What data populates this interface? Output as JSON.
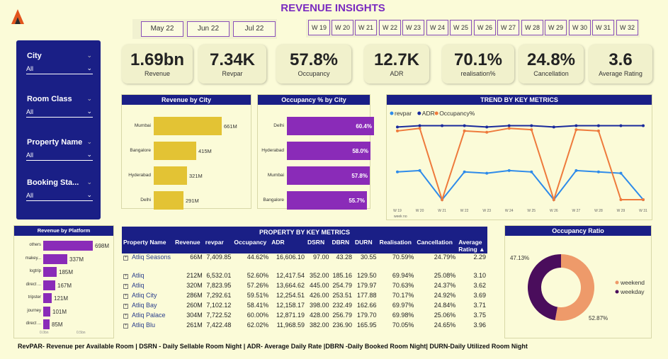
{
  "title": "REVENUE INSIGHTS",
  "months": [
    "May 22",
    "Jun 22",
    "Jul 22"
  ],
  "weeks": [
    "W 19",
    "W 20",
    "W 21",
    "W 22",
    "W 23",
    "W 24",
    "W 25",
    "W 26",
    "W 27",
    "W 28",
    "W 29",
    "W 30",
    "W 31",
    "W 32"
  ],
  "filters": [
    {
      "label": "City",
      "value": "All"
    },
    {
      "label": "Room Class",
      "value": "All"
    },
    {
      "label": "Property Name",
      "value": "All"
    },
    {
      "label": "Booking Sta...",
      "value": "All"
    }
  ],
  "kpis": [
    {
      "value": "1.69bn",
      "label": "Revenue"
    },
    {
      "value": "7.34K",
      "label": "Revpar"
    },
    {
      "value": "57.8%",
      "label": "Occupancy"
    },
    {
      "value": "12.7K",
      "label": "ADR"
    },
    {
      "value": "70.1%",
      "label": "realisation%"
    },
    {
      "value": "24.8%",
      "label": "Cancellation"
    },
    {
      "value": "3.6",
      "label": "Average Rating"
    }
  ],
  "revenue_by_city": {
    "title": "Revenue by City",
    "items": [
      {
        "label": "Mumbai",
        "value": 661,
        "text": "661M"
      },
      {
        "label": "Bangalore",
        "value": 415,
        "text": "415M"
      },
      {
        "label": "Hyderabad",
        "value": 321,
        "text": "321M"
      },
      {
        "label": "Delhi",
        "value": 291,
        "text": "291M"
      }
    ],
    "color": "#E3C334"
  },
  "occupancy_by_city": {
    "title": "Occupancy % by City",
    "items": [
      {
        "label": "Delhi",
        "value": 60.4,
        "text": "60.4%"
      },
      {
        "label": "Hyderabad",
        "value": 58.0,
        "text": "58.0%"
      },
      {
        "label": "Mumbai",
        "value": 57.8,
        "text": "57.8%"
      },
      {
        "label": "Bangalore",
        "value": 55.7,
        "text": "55.7%"
      }
    ],
    "color": "#8A2BB8"
  },
  "revenue_by_platform": {
    "title": "Revenue by Platform",
    "items": [
      {
        "label": "others",
        "value": 698,
        "text": "698M"
      },
      {
        "label": "makey...",
        "value": 337,
        "text": "337M"
      },
      {
        "label": "logtrip",
        "value": 185,
        "text": "185M"
      },
      {
        "label": "direct ...",
        "value": 167,
        "text": "167M"
      },
      {
        "label": "tripster",
        "value": 121,
        "text": "121M"
      },
      {
        "label": "journey",
        "value": 101,
        "text": "101M"
      },
      {
        "label": "direct ...",
        "value": 85,
        "text": "85M"
      }
    ],
    "axis": [
      "0.0bn",
      "0.5bn"
    ],
    "color": "#8A2BB8"
  },
  "chart_data": [
    {
      "type": "line",
      "title": "TREND BY KEY METRICS",
      "xlabel": "week no",
      "legend": "top-left",
      "x": [
        "W 19",
        "W 20",
        "W 21",
        "W 22",
        "W 23",
        "W 24",
        "W 25",
        "W 26",
        "W 27",
        "W 28",
        "W 29",
        "W 31"
      ],
      "series": [
        {
          "name": "revpar",
          "color": "#2E8BEA",
          "values": [
            0.21,
            0.22,
            0.0,
            0.21,
            0.2,
            0.22,
            0.21,
            0.0,
            0.22,
            0.21,
            0.2,
            0.0
          ]
        },
        {
          "name": "ADR",
          "color": "#1A2A9C",
          "values": [
            0.55,
            0.56,
            0.56,
            0.56,
            0.55,
            0.56,
            0.56,
            0.55,
            0.56,
            0.56,
            0.56,
            0.56
          ]
        },
        {
          "name": "Occupancy%",
          "color": "#EE7A3C",
          "values": [
            0.52,
            0.54,
            0.0,
            0.52,
            0.51,
            0.54,
            0.53,
            0.0,
            0.53,
            0.52,
            0.0,
            0.0
          ]
        }
      ]
    },
    {
      "type": "pie",
      "title": "Occupancy Ratio",
      "legend": "right",
      "series": [
        {
          "name": "weekend",
          "value": 52.87,
          "text": "52.87%",
          "color": "#EE9A6A"
        },
        {
          "name": "weekday",
          "value": 47.13,
          "text": "47.13%",
          "color": "#4A0D5C"
        }
      ]
    }
  ],
  "table": {
    "title": "PROPERTY BY KEY METRICS",
    "columns": [
      "Property Name",
      "Revenue",
      "revpar",
      "Occupancy",
      "ADR",
      "DSRN",
      "DBRN",
      "DURN",
      "Realisation",
      "Cancellation",
      "Average Rating"
    ],
    "rows": [
      [
        "Atliq Seasons",
        "66M",
        "7,409.85",
        "44.62%",
        "16,606.10",
        "97.00",
        "43.28",
        "30.55",
        "70.59%",
        "24.79%",
        "2.29"
      ],
      [
        "Atliq",
        "212M",
        "6,532.01",
        "52.60%",
        "12,417.54",
        "352.00",
        "185.16",
        "129.50",
        "69.94%",
        "25.08%",
        "3.10"
      ],
      [
        "Atliq",
        "320M",
        "7,823.95",
        "57.26%",
        "13,664.62",
        "445.00",
        "254.79",
        "179.97",
        "70.63%",
        "24.37%",
        "3.62"
      ],
      [
        "Atliq City",
        "286M",
        "7,292.61",
        "59.51%",
        "12,254.51",
        "426.00",
        "253.51",
        "177.88",
        "70.17%",
        "24.92%",
        "3.69"
      ],
      [
        "Atliq Bay",
        "260M",
        "7,102.12",
        "58.41%",
        "12,158.17",
        "398.00",
        "232.49",
        "162.66",
        "69.97%",
        "24.84%",
        "3.71"
      ],
      [
        "Atliq Palace",
        "304M",
        "7,722.52",
        "60.00%",
        "12,871.19",
        "428.00",
        "256.79",
        "179.70",
        "69.98%",
        "25.06%",
        "3.75"
      ],
      [
        "Atliq Blu",
        "261M",
        "7,422.48",
        "62.02%",
        "11,968.59",
        "382.00",
        "236.90",
        "165.95",
        "70.05%",
        "24.65%",
        "3.96"
      ]
    ]
  },
  "footer": "RevPAR- Revenue per Available Room | DSRN - Daily Sellable Room Night | ADR- Average Daily Rate |DBRN -Daily Booked Room Night| DURN-Daily Utilized Room Night"
}
